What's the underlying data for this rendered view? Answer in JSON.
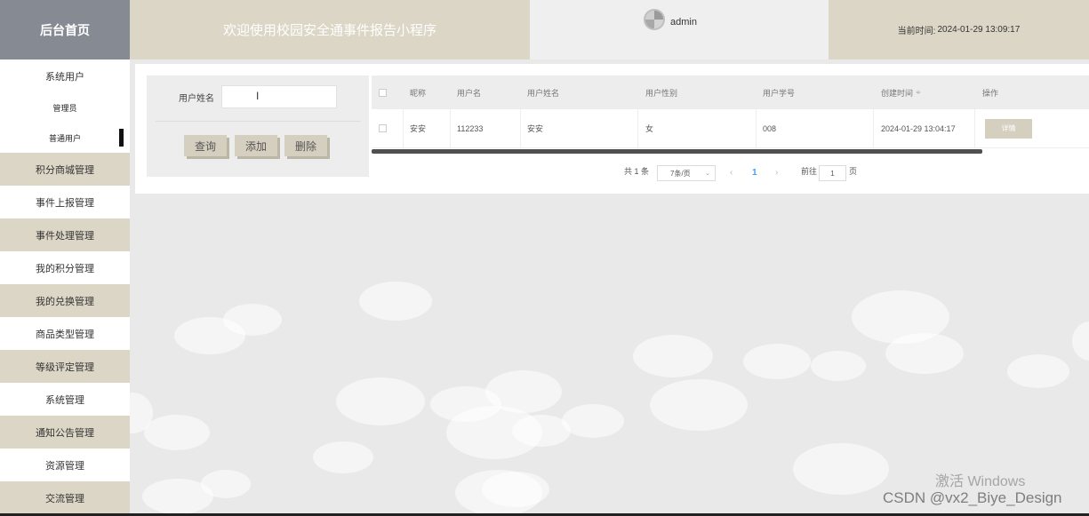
{
  "header": {
    "brand": "后台首页",
    "welcome": "欢迎使用校园安全通事件报告小程序",
    "username": "admin",
    "time_label": "当前时间:",
    "time_value": "2024-01-29 13:09:17"
  },
  "sidebar": {
    "items": [
      {
        "label": "系统用户",
        "children": [
          "管理员",
          "普通用户"
        ]
      },
      {
        "label": "积分商城管理"
      },
      {
        "label": "事件上报管理"
      },
      {
        "label": "事件处理管理"
      },
      {
        "label": "我的积分管理"
      },
      {
        "label": "我的兑换管理"
      },
      {
        "label": "商品类型管理"
      },
      {
        "label": "等级评定管理"
      },
      {
        "label": "系统管理"
      },
      {
        "label": "通知公告管理"
      },
      {
        "label": "资源管理"
      },
      {
        "label": "交流管理"
      }
    ]
  },
  "search": {
    "label": "用户姓名",
    "value": "",
    "query_button": "查询",
    "add_button": "添加",
    "delete_button": "删除"
  },
  "table": {
    "columns": [
      "昵称",
      "用户名",
      "用户姓名",
      "用户性别",
      "用户学号",
      "创建时间",
      "操作"
    ],
    "rows": [
      {
        "nickname": "安安",
        "username": "112233",
        "name": "安安",
        "gender": "女",
        "student_id": "008",
        "created": "2024-01-29 13:04:17",
        "action": "详情"
      }
    ]
  },
  "pagination": {
    "total": "共 1 条",
    "page_size": "7条/页",
    "current_page": "1",
    "goto_label": "前往",
    "goto_value": "1",
    "page_unit": "页"
  },
  "watermark": {
    "activate": "激活 Windows",
    "csdn": "CSDN @vx2_Biye_Design"
  },
  "colors": {
    "tan": "#dcd6c6",
    "brand_bg": "#858a93",
    "page_bg": "#e9e9e9",
    "accent_blue": "#409eff"
  }
}
